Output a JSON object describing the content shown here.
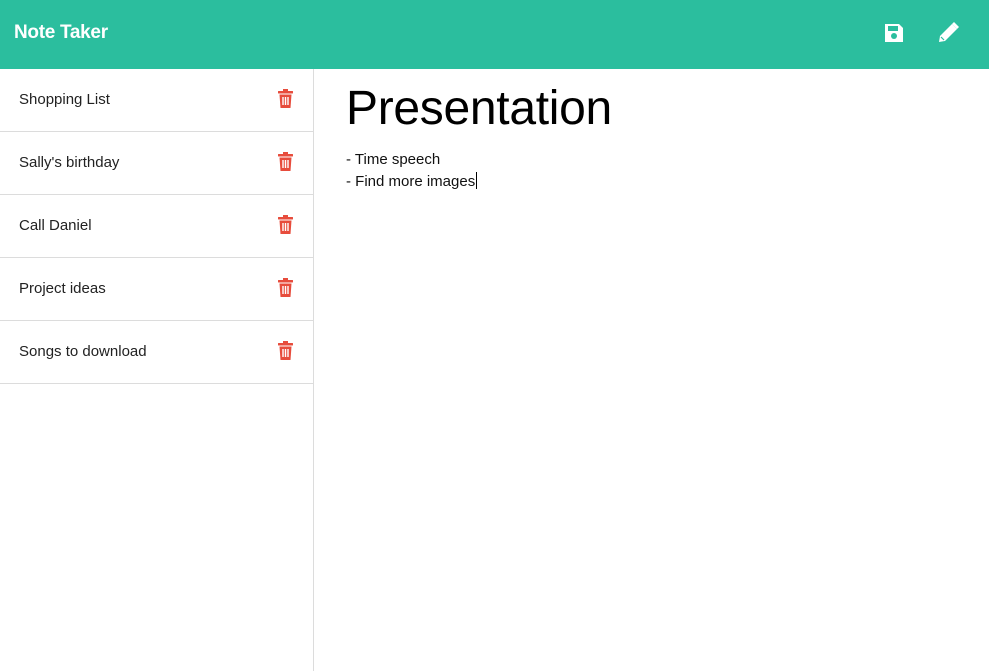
{
  "header": {
    "brand": "Note Taker",
    "save_icon": "save-icon",
    "new_note_icon": "pencil-icon",
    "accent_color": "#2bbe9e"
  },
  "sidebar": {
    "items": [
      {
        "label": "Shopping List"
      },
      {
        "label": "Sally's birthday"
      },
      {
        "label": "Call Daniel"
      },
      {
        "label": "Project ideas"
      },
      {
        "label": "Songs to download"
      }
    ],
    "delete_icon": "trash-icon",
    "delete_color": "#e74c3c"
  },
  "note": {
    "title": "Presentation",
    "lines": [
      "- Time speech",
      "- Find more images"
    ]
  }
}
